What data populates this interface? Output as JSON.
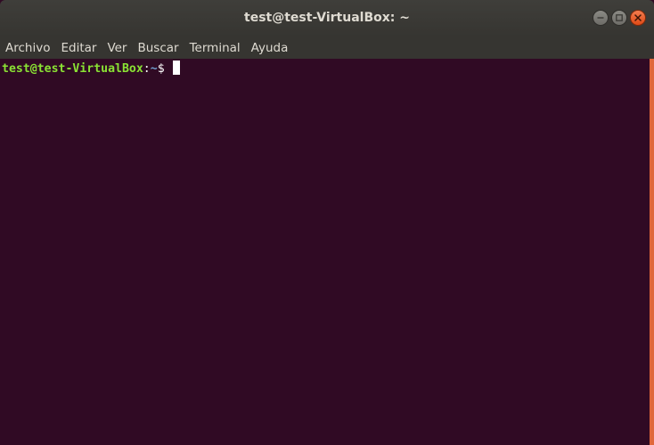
{
  "window": {
    "title": "test@test-VirtualBox: ~",
    "controls": {
      "minimize_icon": "minimize-icon",
      "maximize_icon": "maximize-icon",
      "close_icon": "close-icon"
    }
  },
  "menubar": {
    "items": [
      {
        "label": "Archivo"
      },
      {
        "label": "Editar"
      },
      {
        "label": "Ver"
      },
      {
        "label": "Buscar"
      },
      {
        "label": "Terminal"
      },
      {
        "label": "Ayuda"
      }
    ]
  },
  "terminal": {
    "prompt": {
      "user_host": "test@test-VirtualBox",
      "separator": ":",
      "path": "~",
      "sign": "$ "
    }
  },
  "colors": {
    "terminal_bg": "#300a24",
    "titlebar_bg": "#3c3b37",
    "prompt_user": "#8ae234",
    "prompt_path": "#729fcf",
    "scrollbar_accent": "#e0673a",
    "close_button": "#e95420"
  }
}
